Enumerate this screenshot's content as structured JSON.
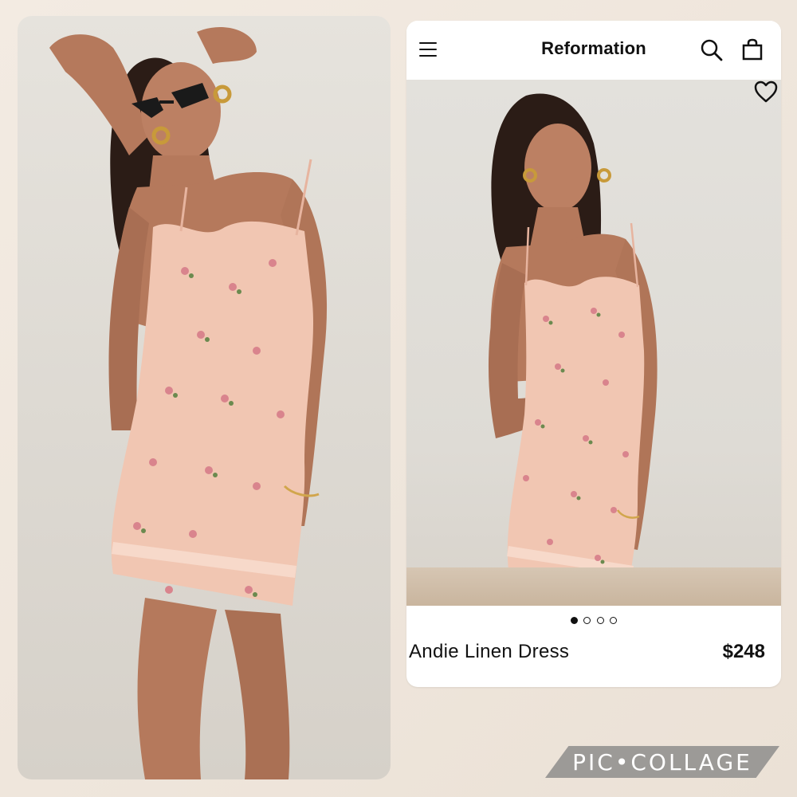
{
  "header": {
    "brand": "Reformation",
    "menu_icon": "hamburger-menu-icon",
    "search_icon": "search-icon",
    "bag_icon": "shopping-bag-icon"
  },
  "product": {
    "name": "Andie Linen Dress",
    "price": "$248",
    "favorite_icon": "heart-icon",
    "image_count": 4,
    "active_image": 1
  },
  "collage": {
    "watermark": "PIC•COLLAGE"
  },
  "colors": {
    "dress": "#f1c6b2",
    "floral_pink": "#d9848d",
    "floral_green": "#6b8a4f",
    "skin": "#b5795c",
    "hair": "#2b1c16",
    "watermark_bg": "#9c9a97"
  }
}
